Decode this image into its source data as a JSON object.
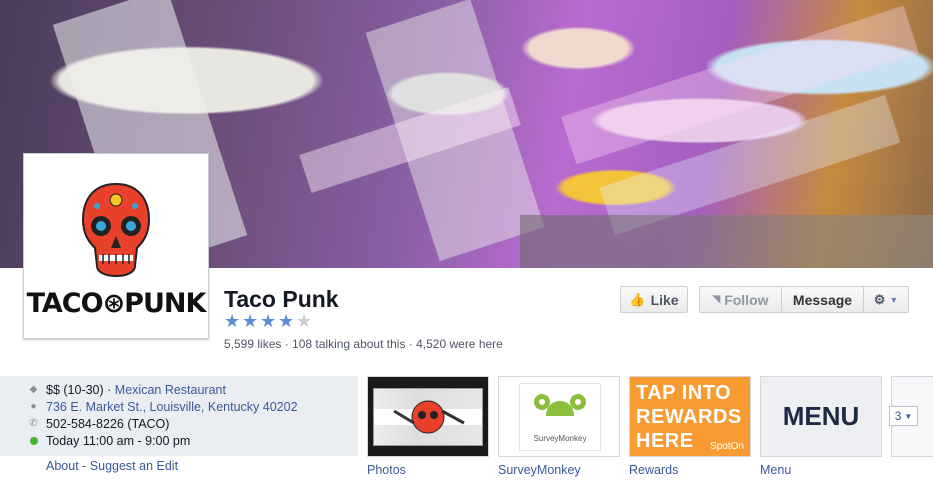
{
  "page": {
    "name": "Taco Punk",
    "rating_stars": 4,
    "rating_max": 5,
    "stats": "5,599 likes · 108 talking about this · 4,520 were here",
    "logo_text": "TACO⊛PUNK"
  },
  "buttons": {
    "like": "Like",
    "follow": "Follow",
    "message": "Message"
  },
  "info": {
    "price": "$$ (10-30)",
    "separator": " · ",
    "category": "Mexican Restaurant",
    "address": "736 E. Market St., Louisville, Kentucky 40202",
    "phone": "502-584-8226 (TACO)",
    "hours": "Today 11:00 am - 9:00 pm",
    "about_link": "About",
    "edit_link": "Suggest an Edit",
    "link_separator": " - "
  },
  "apps": [
    {
      "label": "Photos"
    },
    {
      "label": "SurveyMonkey",
      "brand": "SurveyMonkey"
    },
    {
      "label": "Rewards",
      "lines": [
        "TAP INTO",
        "REWARDS",
        "HERE"
      ],
      "brand": "SpotOn"
    },
    {
      "label": "Menu",
      "title": "MENU"
    }
  ],
  "more_count": "3",
  "colors": {
    "link": "#3b5998",
    "star_on": "#5b8ed6",
    "rewards_bg": "#f79b32",
    "open_dot": "#42b72a"
  }
}
